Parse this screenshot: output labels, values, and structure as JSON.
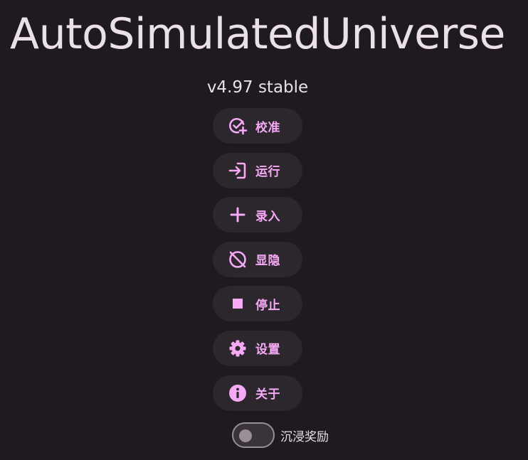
{
  "app": {
    "title": "AutoSimulatedUniverse",
    "version": "v4.97 stable"
  },
  "menu": {
    "items": [
      {
        "label": "校准",
        "icon": "calibrate-check-plus-icon"
      },
      {
        "label": "运行",
        "icon": "login-arrow-icon"
      },
      {
        "label": "录入",
        "icon": "plus-icon"
      },
      {
        "label": "显隐",
        "icon": "visibility-off-icon"
      },
      {
        "label": "停止",
        "icon": "stop-square-icon"
      },
      {
        "label": "设置",
        "icon": "gear-icon"
      },
      {
        "label": "关于",
        "icon": "info-icon"
      }
    ]
  },
  "toggle": {
    "label": "沉浸奖励",
    "state": "off"
  },
  "colors": {
    "background": "#1e1a1f",
    "button_bg": "#2c262d",
    "accent": "#f6a9f4",
    "text": "#ebe0ea",
    "switch_outline": "#9a8e99"
  }
}
